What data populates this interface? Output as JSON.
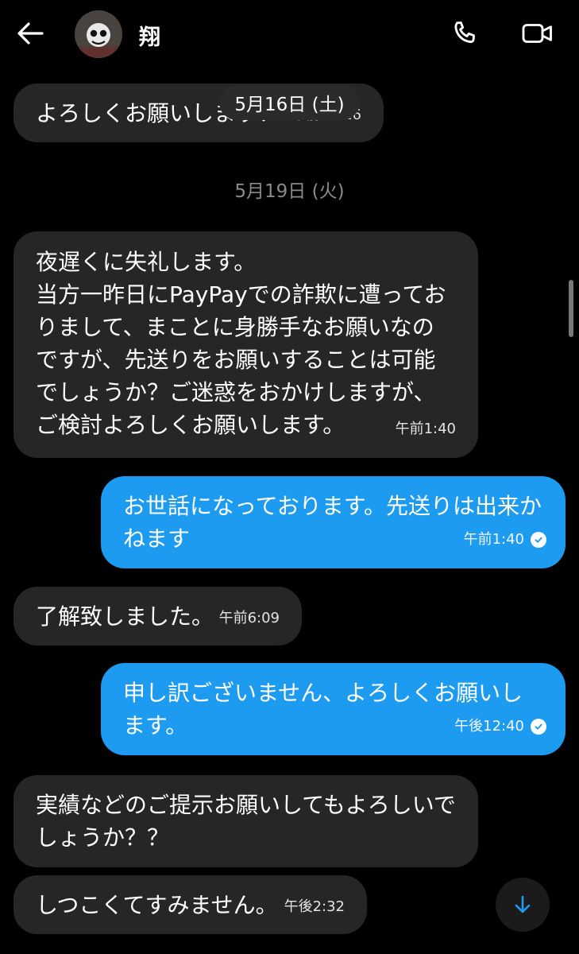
{
  "header": {
    "contact_name": "翔",
    "back_icon": "back-arrow-icon",
    "call_icon": "phone-icon",
    "video_icon": "video-camera-icon"
  },
  "sticky_date": "5月16日 (土)",
  "date_separator": "5月19日 (火)",
  "messages": [
    {
      "direction": "in",
      "text": "よろしくお願いします！",
      "time": "午前12:16"
    },
    {
      "direction": "in",
      "text": "夜遅くに失礼します。\n当方一昨日にPayPayでの詐欺に遭っておりまして、まことに身勝手なお願いなのですが、先送りをお願いすることは可能でしょうか？ご迷惑をおかけしますが、ご検討よろしくお願いします。",
      "time": "午前1:40"
    },
    {
      "direction": "out",
      "text": "お世話になっております。先送りは出来かねます",
      "time": "午前1:40",
      "status": "read"
    },
    {
      "direction": "in",
      "text": "了解致しました。",
      "time": "午前6:09"
    },
    {
      "direction": "out",
      "text": "申し訳ございません、よろしくお願いします。",
      "time": "午後12:40",
      "status": "read"
    },
    {
      "direction": "in",
      "text": "実績などのご提示お願いしてもよろしいでしょうか？？",
      "time": ""
    },
    {
      "direction": "in",
      "text": "しつこくてすみません。",
      "time": "午後2:32"
    }
  ],
  "colors": {
    "background": "#000000",
    "incoming_bubble": "#262626",
    "outgoing_bubble": "#1d9bf0",
    "accent": "#1d9bf0"
  }
}
